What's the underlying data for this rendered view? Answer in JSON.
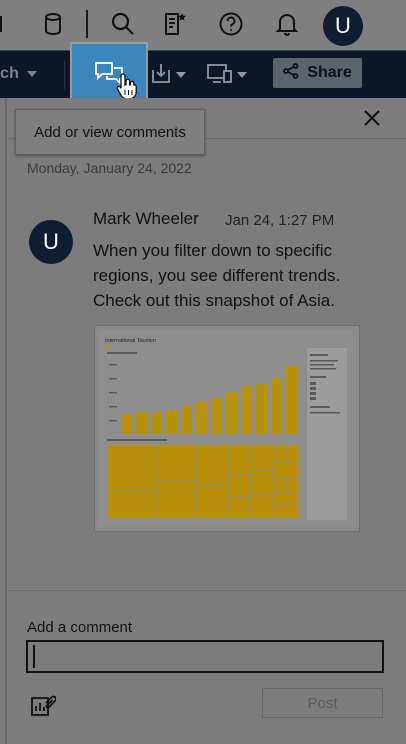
{
  "header": {
    "icons": [
      "database-icon",
      "search-icon",
      "favorites-list-icon",
      "help-icon",
      "notifications-icon"
    ],
    "user_initial": "U"
  },
  "toolbar": {
    "search_fragment": "ch",
    "share_label": "Share",
    "tooltip": "Add or view comments",
    "active_button": "comments"
  },
  "comments": {
    "date_heading": "Monday, January 24, 2022",
    "items": [
      {
        "author": "Mark Wheeler",
        "initial": "U",
        "time": "Jan 24, 1:27 PM",
        "text": "When you filter down to specific regions, you see different trends. Check out this snapshot of Asia."
      }
    ]
  },
  "snapshot": {
    "title": "International Tourism"
  },
  "compose": {
    "label": "Add a comment",
    "value": "",
    "placeholder": "",
    "post_label": "Post"
  },
  "colors": {
    "toolbar_bg": "#0c1627",
    "active_button": "#3a86bd",
    "avatar_bg": "#0f1d33",
    "chart_bar": "#b8900a"
  }
}
